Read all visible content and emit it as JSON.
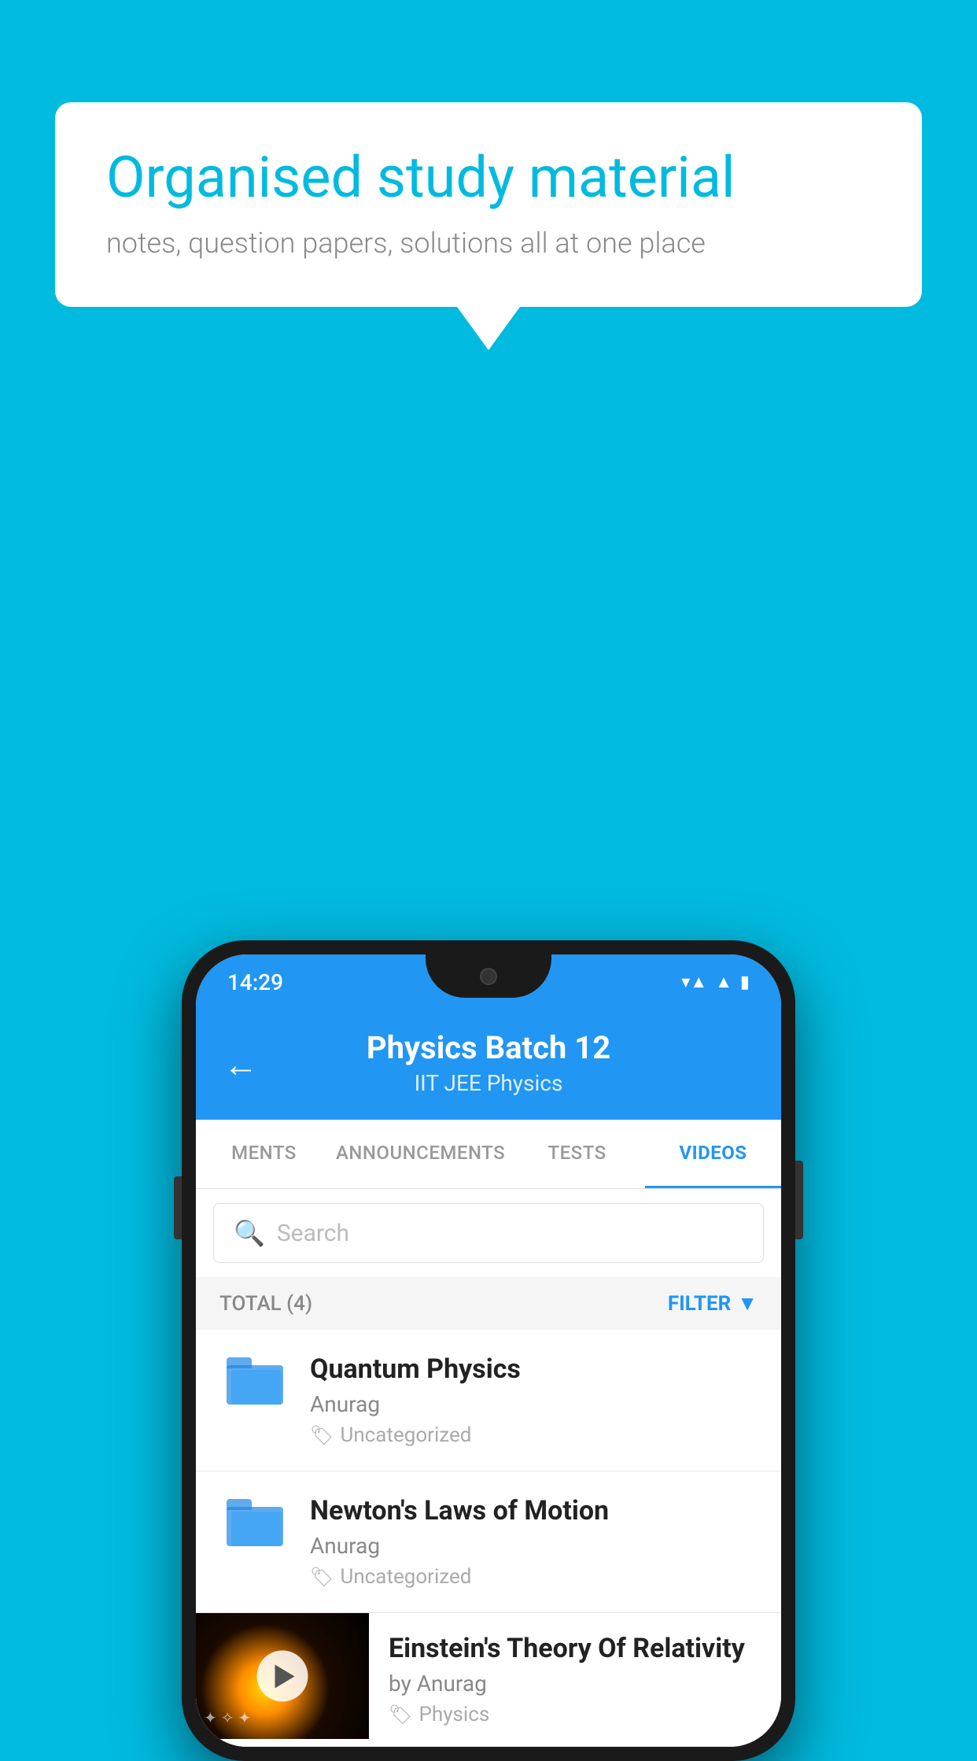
{
  "background_color": "#00BADF",
  "speech_bubble": {
    "title": "Organised study material",
    "subtitle": "notes, question papers, solutions all at one place"
  },
  "phone": {
    "status_bar": {
      "time": "14:29",
      "icons": [
        "wifi",
        "signal",
        "battery"
      ]
    },
    "header": {
      "back_label": "←",
      "title": "Physics Batch 12",
      "subtitle": "IIT JEE   Physics"
    },
    "tabs": [
      {
        "label": "MENTS",
        "active": false
      },
      {
        "label": "ANNOUNCEMENTS",
        "active": false
      },
      {
        "label": "TESTS",
        "active": false
      },
      {
        "label": "VIDEOS",
        "active": true
      }
    ],
    "search": {
      "placeholder": "Search"
    },
    "filter_bar": {
      "total_label": "TOTAL (4)",
      "filter_label": "FILTER"
    },
    "video_items": [
      {
        "type": "folder",
        "title": "Quantum Physics",
        "author": "Anurag",
        "tag": "Uncategorized"
      },
      {
        "type": "folder",
        "title": "Newton's Laws of Motion",
        "author": "Anurag",
        "tag": "Uncategorized"
      },
      {
        "type": "thumb",
        "title": "Einstein's Theory Of Relativity",
        "author": "by Anurag",
        "tag": "Physics"
      }
    ]
  }
}
